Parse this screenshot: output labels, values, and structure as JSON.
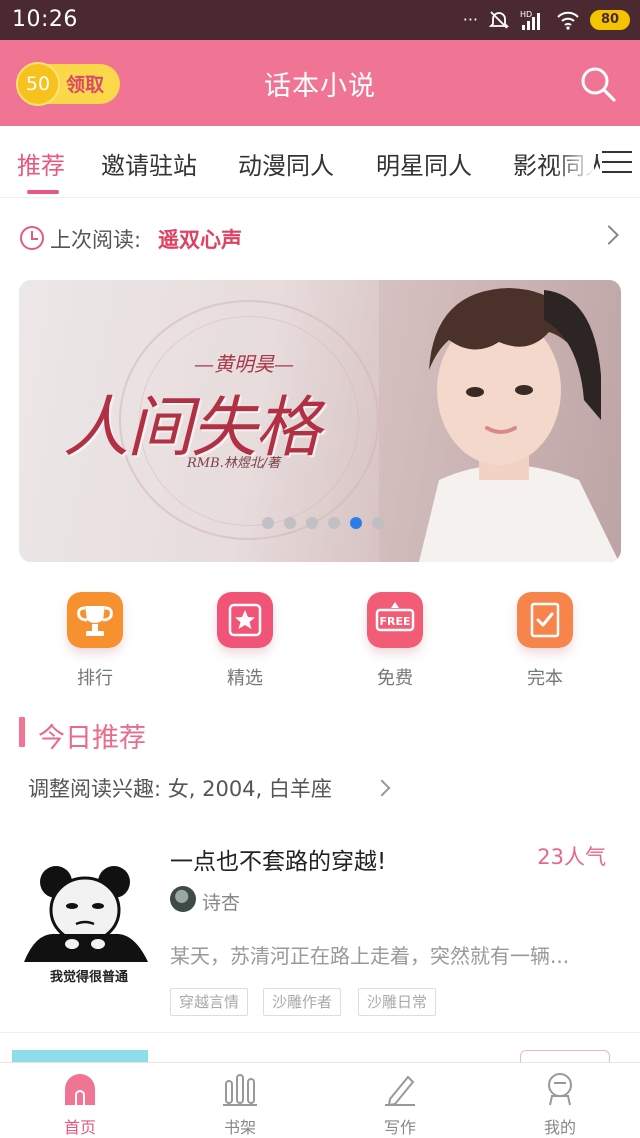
{
  "status_bar": {
    "time": "10:26",
    "network": "HD",
    "battery": "80"
  },
  "header": {
    "coin_amount": "50",
    "coin_action": "领取",
    "title": "话本小说"
  },
  "tabs": [
    {
      "label": "推荐",
      "active": true
    },
    {
      "label": "邀请驻站",
      "active": false
    },
    {
      "label": "动漫同人",
      "active": false
    },
    {
      "label": "明星同人",
      "active": false
    },
    {
      "label": "影视同人",
      "active": false
    }
  ],
  "last_read": {
    "label": "上次阅读:",
    "title": "遥双心声"
  },
  "banner": {
    "author_top": "—黄明昊—",
    "title": "人间失格",
    "author_bottom": "RMB.林煜北/著",
    "slide_count": 6,
    "active_slide": 5
  },
  "quick_entries": [
    {
      "label": "排行",
      "icon": "trophy-icon",
      "color": "#f7902f"
    },
    {
      "label": "精选",
      "icon": "star-icon",
      "color": "#f25478"
    },
    {
      "label": "免费",
      "icon": "free-tag-icon",
      "color": "#f25c75"
    },
    {
      "label": "完本",
      "icon": "check-note-icon",
      "color": "#f7844a"
    }
  ],
  "section": {
    "title": "今日推荐",
    "interest": "调整阅读兴趣: 女, 2004, 白羊座"
  },
  "book": {
    "cover_caption": "我觉得很普通",
    "title": "一点也不套路的穿越!",
    "popularity": "23人气",
    "author": "诗杏",
    "description": "某天，苏清河正在路上走着，突然就有一辆...",
    "tags": [
      "穿越言情",
      "沙雕作者",
      "沙雕日常"
    ]
  },
  "bottom_nav": [
    {
      "label": "首页",
      "icon": "home-icon",
      "active": true
    },
    {
      "label": "书架",
      "icon": "bookshelf-icon",
      "active": false
    },
    {
      "label": "写作",
      "icon": "pen-icon",
      "active": false
    },
    {
      "label": "我的",
      "icon": "profile-icon",
      "active": false
    }
  ],
  "colors": {
    "brand_pink": "#f07493",
    "accent_red": "#e8587f",
    "dot_active": "#2d7ce8"
  }
}
